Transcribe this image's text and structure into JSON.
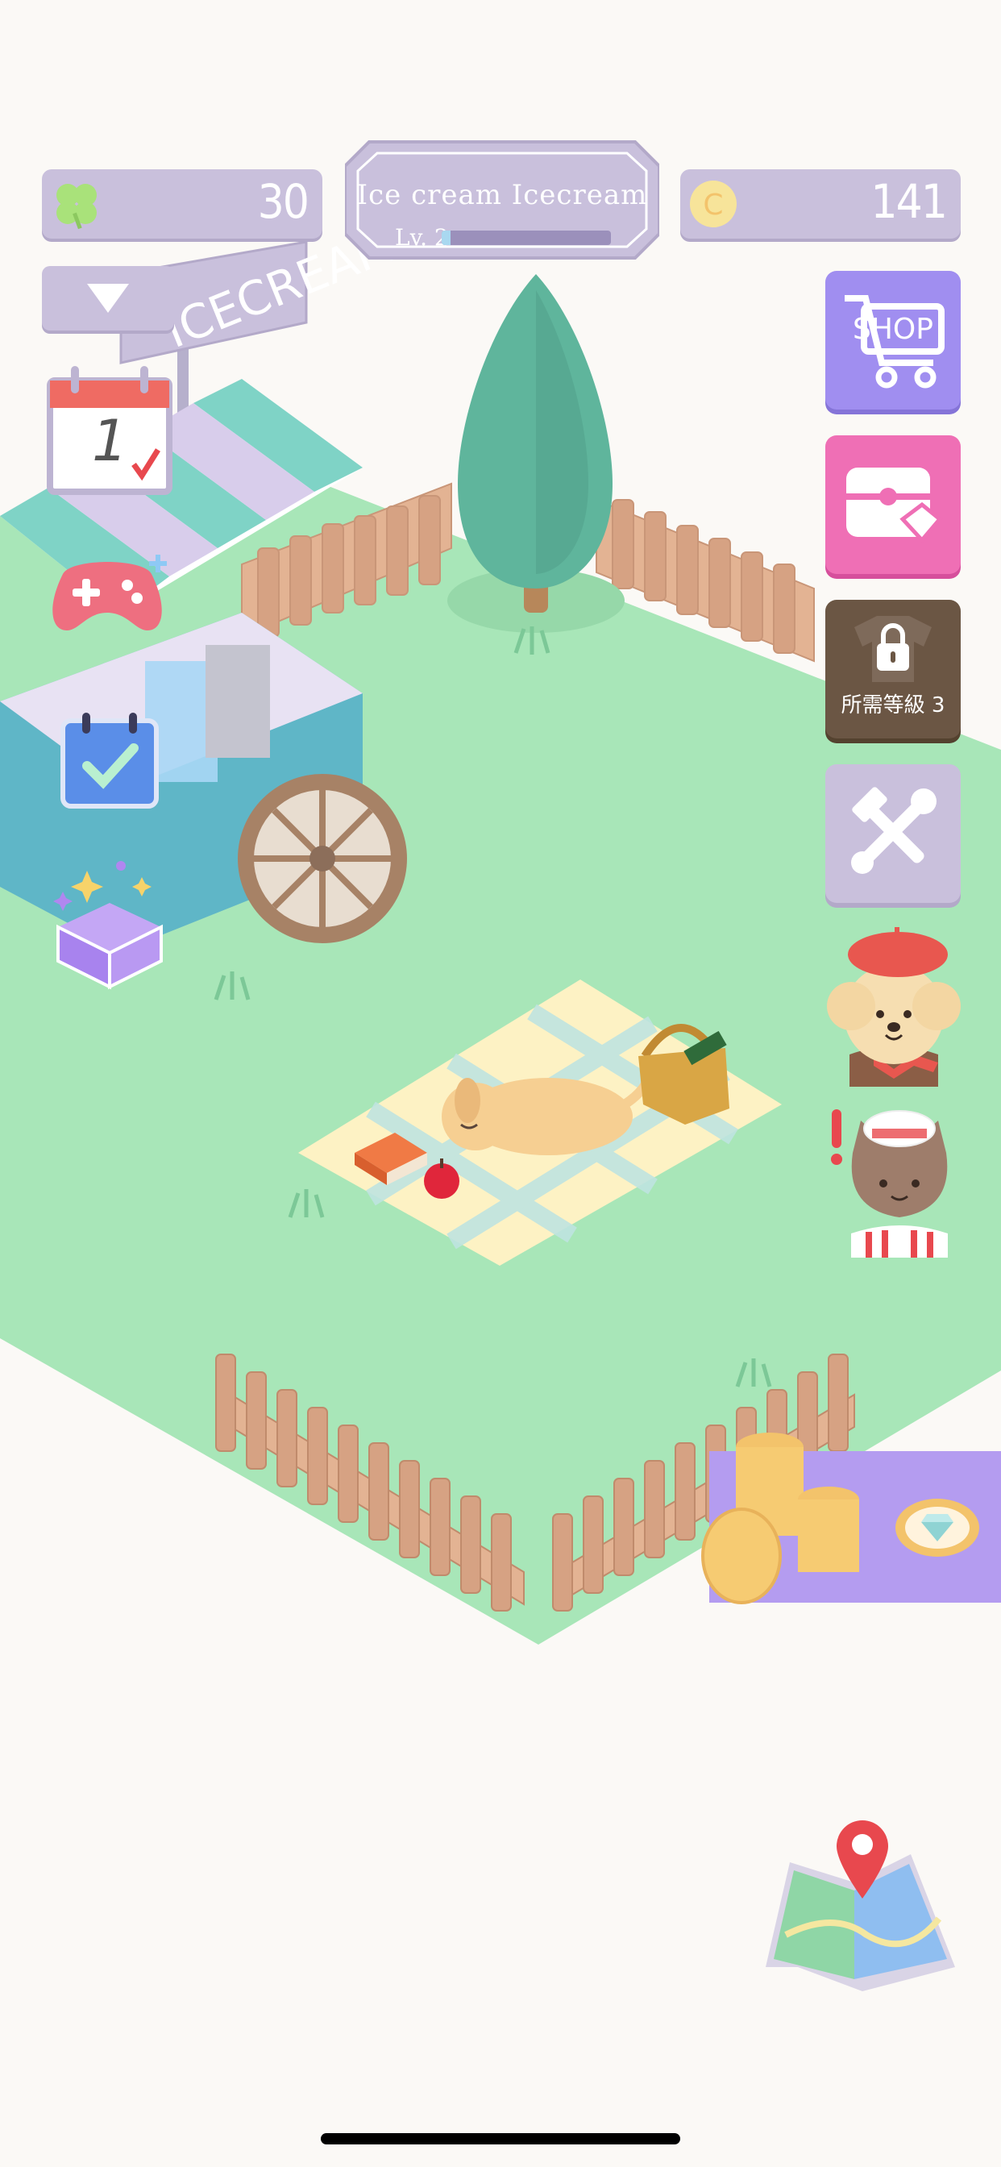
{
  "hud": {
    "clover_count": "30",
    "coin_count": "141",
    "shop_title": "Ice cream Icecream",
    "level_label": "Lv. 2",
    "level_progress": 0.05
  },
  "sign": {
    "text": "ICECREAM"
  },
  "calendar": {
    "day": "1"
  },
  "buttons": {
    "shop_label": "SHOP",
    "locked_label": "所需等級 3"
  },
  "colors": {
    "grass": "#a8e6b8",
    "panel": "#c9c0dc",
    "shop": "#a08ef0",
    "gift": "#ef6fb5",
    "locked": "#6b5644",
    "coin_tray": "#b49cf0"
  },
  "icons": {
    "clover": "four-leaf-clover-icon",
    "coin": "coin-icon",
    "dropdown": "triangle-down-icon",
    "calendar": "daily-calendar-icon",
    "game": "gamepad-icon",
    "checklist": "checklist-icon",
    "gift_box": "sparkle-box-icon",
    "shop": "shopping-cart-icon",
    "chest": "treasure-chest-icon",
    "lock": "lock-icon",
    "tools": "hammer-wrench-icon",
    "dog": "poodle-character-icon",
    "cat": "chef-cat-character-icon",
    "diamond": "diamond-icon",
    "map": "map-pin-icon"
  }
}
